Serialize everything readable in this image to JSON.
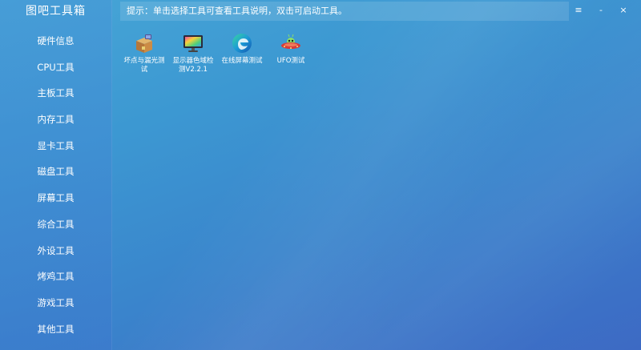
{
  "app": {
    "title": "图吧工具箱"
  },
  "hint": {
    "text": "提示：单击选择工具可查看工具说明，双击可启动工具。"
  },
  "window_controls": {
    "pin": "≡",
    "minimize": "-",
    "close": "×"
  },
  "sidebar": {
    "items": [
      {
        "label": "硬件信息"
      },
      {
        "label": "CPU工具"
      },
      {
        "label": "主板工具"
      },
      {
        "label": "内存工具"
      },
      {
        "label": "显卡工具"
      },
      {
        "label": "磁盘工具"
      },
      {
        "label": "屏幕工具"
      },
      {
        "label": "综合工具"
      },
      {
        "label": "外设工具"
      },
      {
        "label": "烤鸡工具"
      },
      {
        "label": "游戏工具"
      },
      {
        "label": "其他工具"
      }
    ]
  },
  "tools": [
    {
      "label": "坏点与漏光测试",
      "icon": "box-icon"
    },
    {
      "label": "显示器色域检测V2.2.1",
      "icon": "monitor-icon"
    },
    {
      "label": "在线屏幕测试",
      "icon": "edge-browser-icon"
    },
    {
      "label": "UFO测试",
      "icon": "ufo-icon"
    }
  ],
  "colors": {
    "background_start": "#47a6d6",
    "background_end": "#3d6ac4",
    "text": "#ffffff"
  }
}
